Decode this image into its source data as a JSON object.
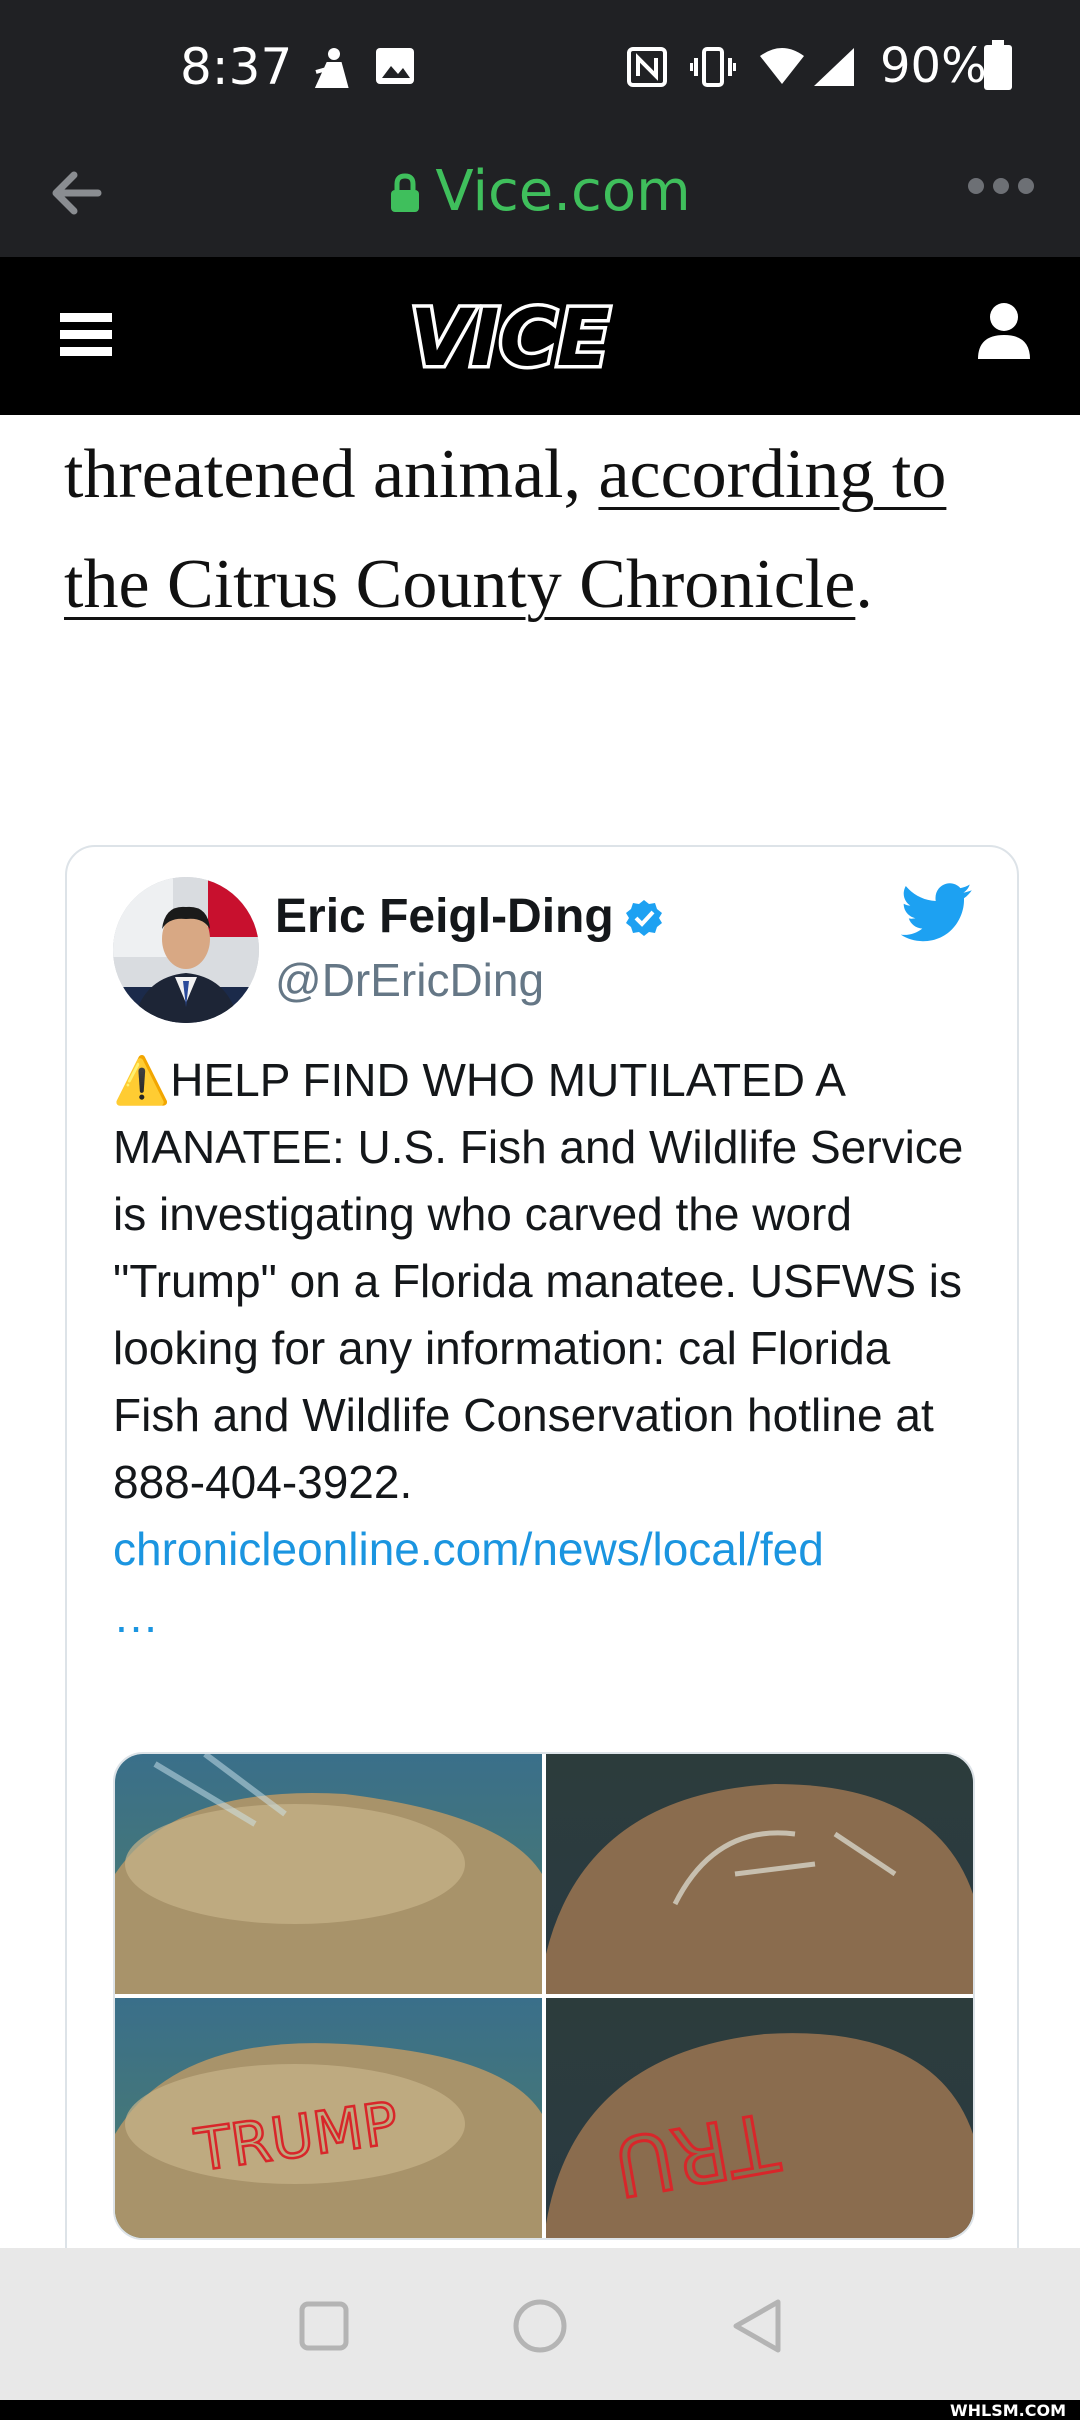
{
  "status_bar": {
    "time": "8:37",
    "battery": "90%"
  },
  "browser": {
    "url": "Vice.com"
  },
  "site": {
    "logo": "VICE"
  },
  "article": {
    "text_before": "threatened animal, ",
    "link_text": "according to the Citrus County Chronicle",
    "text_after": "."
  },
  "tweet": {
    "name": "Eric Feigl-Ding",
    "handle": "@DrEricDing",
    "emoji": "⚠️",
    "body": "HELP FIND WHO MUTILATED A MANATEE: U.S. Fish and Wildlife Service is investigating who carved the word \"Trump\" on a Florida manatee. USFWS is looking for any information: cal Florida Fish and Wildlife Conservation hotline at 888-404-3922.",
    "link": "chronicleonline.com/news/local/fed",
    "ellipsis": "…",
    "media": {
      "carved_text": [
        "TRUMP",
        "TRU"
      ]
    }
  },
  "watermark": "WHLSM.COM",
  "colors": {
    "url_green": "#3fbf5c",
    "twitter_blue": "#1da1f2",
    "link_blue": "#1b95e0"
  }
}
